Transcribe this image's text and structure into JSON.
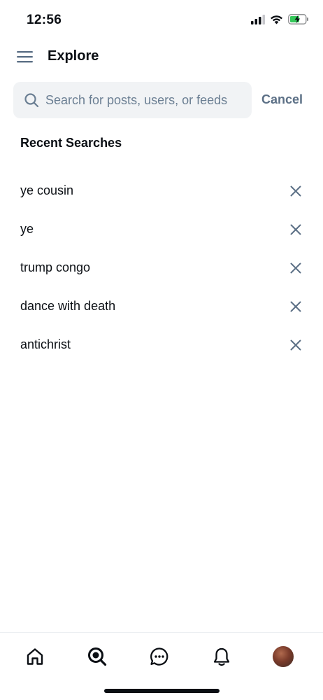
{
  "status_bar": {
    "time": "12:56"
  },
  "header": {
    "title": "Explore"
  },
  "search": {
    "placeholder": "Search for posts, users, or feeds",
    "value": "",
    "cancel_label": "Cancel"
  },
  "recent": {
    "title": "Recent Searches",
    "items": [
      {
        "label": "ye cousin"
      },
      {
        "label": "ye"
      },
      {
        "label": "trump congo"
      },
      {
        "label": "dance with death"
      },
      {
        "label": "antichrist"
      }
    ]
  },
  "tabs": [
    {
      "icon": "home-icon"
    },
    {
      "icon": "search-icon",
      "active": true
    },
    {
      "icon": "chat-icon"
    },
    {
      "icon": "bell-icon"
    },
    {
      "icon": "avatar"
    }
  ],
  "colors": {
    "accent_muted": "#5c7086",
    "text": "#0b0f14",
    "search_bg": "#f1f3f5"
  }
}
